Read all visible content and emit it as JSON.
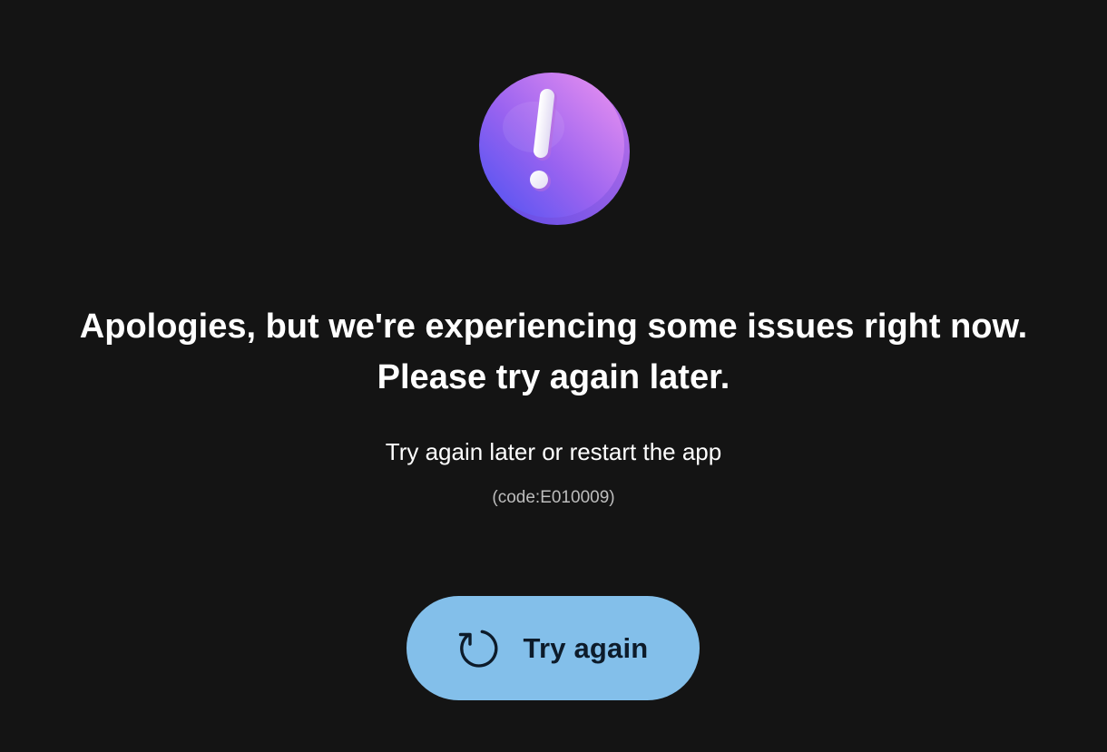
{
  "error_screen": {
    "icon": "exclamation-alert-icon",
    "headline_line1": "Apologies, but we're experiencing some issues right now.",
    "headline_line2": "Please try again later.",
    "subtitle": "Try again later or restart the app",
    "error_code": "(code:E010009)",
    "retry_button": {
      "label": "Try again",
      "icon": "refresh-icon"
    }
  },
  "colors": {
    "background": "#141414",
    "text_primary": "#ffffff",
    "text_secondary": "#bdbdbd",
    "button_fill": "#83bfea",
    "button_text": "#0d1b2a",
    "icon_gradient_start": "#5a4ef0",
    "icon_gradient_end": "#e48cf0"
  }
}
